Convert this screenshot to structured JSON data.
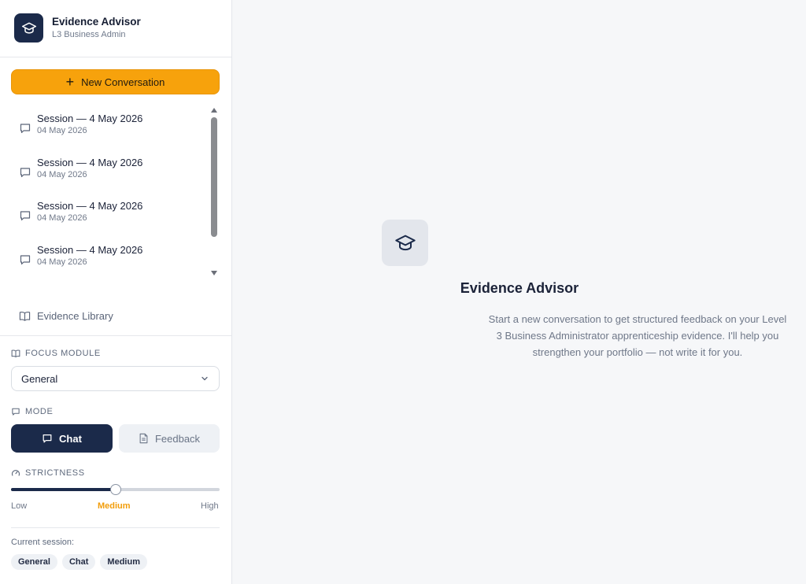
{
  "app": {
    "title": "Evidence Advisor",
    "subtitle": "L3 Business Admin"
  },
  "sidebar": {
    "new_conversation_label": "New Conversation",
    "sessions": [
      {
        "title": "Session — 4 May 2026",
        "date": "04 May 2026"
      },
      {
        "title": "Session — 4 May 2026",
        "date": "04 May 2026"
      },
      {
        "title": "Session — 4 May 2026",
        "date": "04 May 2026"
      },
      {
        "title": "Session — 4 May 2026",
        "date": "04 May 2026"
      }
    ],
    "library_label": "Evidence Library",
    "focus_module": {
      "label": "FOCUS MODULE",
      "selected": "General"
    },
    "mode": {
      "label": "MODE",
      "chat_label": "Chat",
      "feedback_label": "Feedback",
      "selected": "Chat"
    },
    "strictness": {
      "label": "STRICTNESS",
      "low": "Low",
      "medium": "Medium",
      "high": "High",
      "level": 0.5
    },
    "current_session": {
      "label": "Current session:",
      "chips": [
        "General",
        "Chat",
        "Medium"
      ]
    }
  },
  "main": {
    "title": "Evidence Advisor",
    "description": "Start a new conversation to get structured feedback on your Level 3 Business Administrator apprenticeship evidence. I'll help you strengthen your portfolio — not write it for you."
  },
  "colors": {
    "accent": "#f7a20c",
    "primary": "#1b2a4a"
  },
  "icons": [
    "graduation-cap-icon",
    "plus-icon",
    "chat-bubble-icon",
    "book-icon",
    "chevron-down-icon",
    "document-icon",
    "gauge-icon"
  ]
}
